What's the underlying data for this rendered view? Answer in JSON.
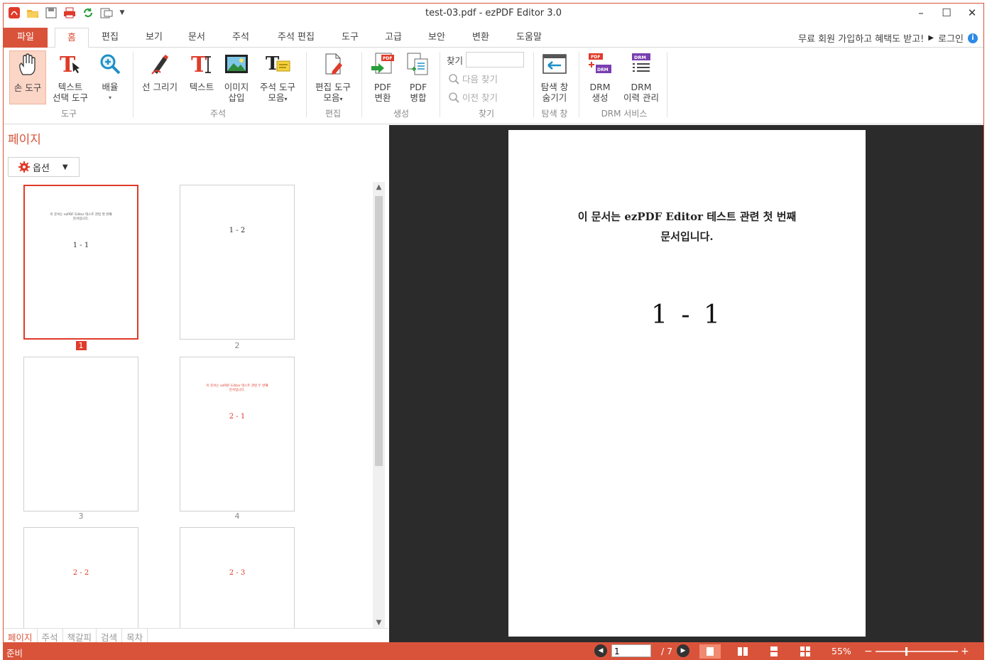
{
  "window": {
    "title": "test-03.pdf - ezPDF Editor 3.0",
    "accent_color": "#d9533a"
  },
  "quick_access": [
    "app-logo-icon",
    "open-folder-icon",
    "save-icon",
    "print-icon",
    "refresh-icon",
    "page-setup-icon",
    "dropdown-icon"
  ],
  "window_controls": {
    "minimize": "–",
    "maximize": "☐",
    "close": "✕"
  },
  "menu": {
    "file": "파일",
    "tabs": [
      "홈",
      "편집",
      "보기",
      "문서",
      "주석",
      "주석 편집",
      "도구",
      "고급",
      "보안",
      "변환",
      "도움말"
    ],
    "active_tab": "홈",
    "signup": "무료 회원 가입하고 혜택도 받고!",
    "login": "로그인",
    "info": "i"
  },
  "ribbon": {
    "hand_tool": "손 도구",
    "text_select_1": "텍스트",
    "text_select_2": "선택 도구",
    "zoom": "배율",
    "group_tools": "도구",
    "draw_line": "선 그리기",
    "text": "텍스트",
    "insert_image_1": "이미지",
    "insert_image_2": "삽입",
    "annot_tools_1": "주석 도구",
    "annot_tools_2": "모음",
    "group_annotation": "주석",
    "edit_tools_1": "편집 도구",
    "edit_tools_2": "모음",
    "group_edit": "편집",
    "pdf_convert_1": "PDF",
    "pdf_convert_2": "변환",
    "pdf_merge_1": "PDF",
    "pdf_merge_2": "병합",
    "group_create": "생성",
    "find_label": "찾기",
    "find_next": "다음 찾기",
    "find_prev": "이전 찾기",
    "group_find": "찾기",
    "hide_nav_1": "탐색 창",
    "hide_nav_2": "숨기기",
    "group_nav": "탐색 창",
    "drm_create_1": "DRM",
    "drm_create_2": "생성",
    "drm_history_1": "DRM",
    "drm_history_2": "이력 관리",
    "group_drm": "DRM 서비스"
  },
  "left_panel": {
    "title": "페이지",
    "options_button": "옵션",
    "thumbnails": [
      {
        "label": "1",
        "line1": "이 문서는 ezPDF Editor 테스트 관련 첫 번째",
        "line2": "문서입니다.",
        "num": "1 - 1",
        "selected": true,
        "red": false
      },
      {
        "label": "2",
        "line1": "",
        "line2": "",
        "num": "1 - 2",
        "selected": false,
        "red": false
      },
      {
        "label": "3",
        "line1": "",
        "line2": "",
        "num": "",
        "selected": false,
        "red": false
      },
      {
        "label": "4",
        "line1": "이 문서는 ezPDF Editor 테스트 관련 두 번째",
        "line2": "문서입니다.",
        "num": "2 - 1",
        "selected": false,
        "red": true
      },
      {
        "label": "",
        "line1": "",
        "line2": "",
        "num": "2 - 2",
        "selected": false,
        "red": true
      },
      {
        "label": "",
        "line1": "",
        "line2": "",
        "num": "2 - 3",
        "selected": false,
        "red": true
      }
    ],
    "bottom_tabs": [
      "페이지",
      "주석",
      "책갈피",
      "검색",
      "목차"
    ],
    "active_bottom_tab": "페이지"
  },
  "document": {
    "line1": "이 문서는 ezPDF Editor 테스트 관련 첫 번째",
    "line2": "문서입니다.",
    "page_number_text": "1 - 1"
  },
  "status": {
    "ready": "준비",
    "current_page": "1",
    "total_pages": "/ 7",
    "zoom": "55%",
    "zoom_minus": "−",
    "zoom_plus": "+"
  }
}
